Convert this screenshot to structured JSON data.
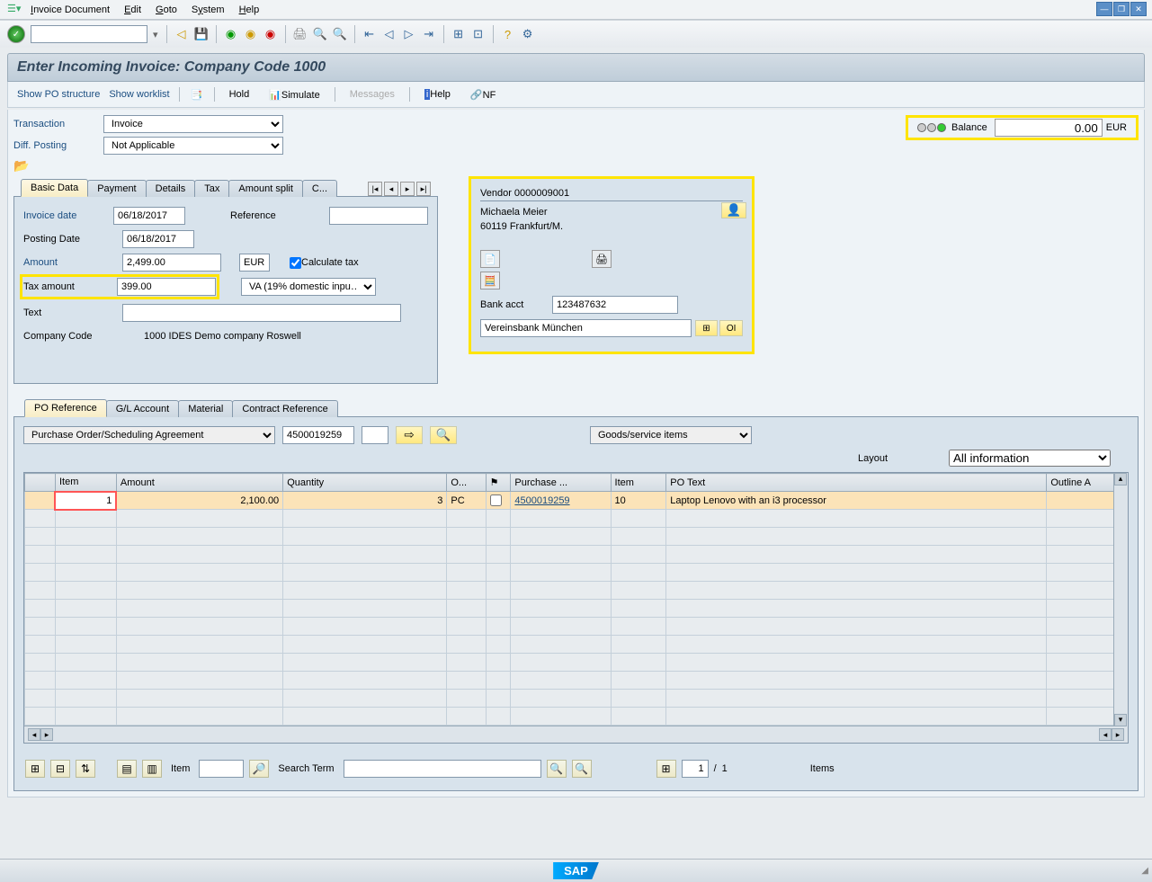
{
  "menubar": {
    "items": [
      "Invoice Document",
      "Edit",
      "Goto",
      "System",
      "Help"
    ]
  },
  "title": "Enter Incoming Invoice: Company Code 1000",
  "subtoolbar": {
    "show_po_structure": "Show PO structure",
    "show_worklist": "Show worklist",
    "hold": "Hold",
    "simulate": "Simulate",
    "messages": "Messages",
    "help": "Help",
    "nf": "NF"
  },
  "header": {
    "transaction_label": "Transaction",
    "transaction_value": "Invoice",
    "diff_posting_label": "Diff. Posting",
    "diff_posting_value": "Not Applicable",
    "balance_label": "Balance",
    "balance_value": "0.00",
    "balance_currency": "EUR"
  },
  "tabs_upper": [
    "Basic Data",
    "Payment",
    "Details",
    "Tax",
    "Amount split",
    "C..."
  ],
  "basic_data": {
    "invoice_date_label": "Invoice date",
    "invoice_date": "06/18/2017",
    "reference_label": "Reference",
    "reference": "",
    "posting_date_label": "Posting Date",
    "posting_date": "06/18/2017",
    "amount_label": "Amount",
    "amount": "2,499.00",
    "currency": "EUR",
    "calculate_tax_label": "Calculate tax",
    "tax_amount_label": "Tax amount",
    "tax_amount": "399.00",
    "tax_code": "VA (19% domestic inpu…",
    "text_label": "Text",
    "text": "",
    "company_code_label": "Company Code",
    "company_code": "1000 IDES Demo company Roswell"
  },
  "vendor": {
    "header": "Vendor 0000009001",
    "name": "Michaela Meier",
    "address": "60119 Frankfurt/M.",
    "bank_acct_label": "Bank acct",
    "bank_acct": "123487632",
    "bank_name": "Vereinsbank München",
    "oi": "OI"
  },
  "tabs_lower": [
    "PO Reference",
    "G/L Account",
    "Material",
    "Contract Reference"
  ],
  "po_ref": {
    "ref_type": "Purchase Order/Scheduling Agreement",
    "po_number": "4500019259",
    "goods_dropdown": "Goods/service items",
    "layout_label": "Layout",
    "layout_value": "All information"
  },
  "grid": {
    "columns": [
      "Item",
      "Amount",
      "Quantity",
      "O...",
      "",
      "Purchase ...",
      "Item",
      "PO Text",
      "Outline A"
    ],
    "row": {
      "item": "1",
      "amount": "2,100.00",
      "quantity": "3",
      "uom": "PC",
      "po": "4500019259",
      "po_item": "10",
      "po_text": "Laptop Lenovo with an i3 processor"
    }
  },
  "bottom": {
    "item_label": "Item",
    "search_term_label": "Search Term",
    "page": "1",
    "page_sep": "/",
    "page_total": "1",
    "items_label": "Items"
  },
  "footer": {
    "logo": "SAP"
  }
}
